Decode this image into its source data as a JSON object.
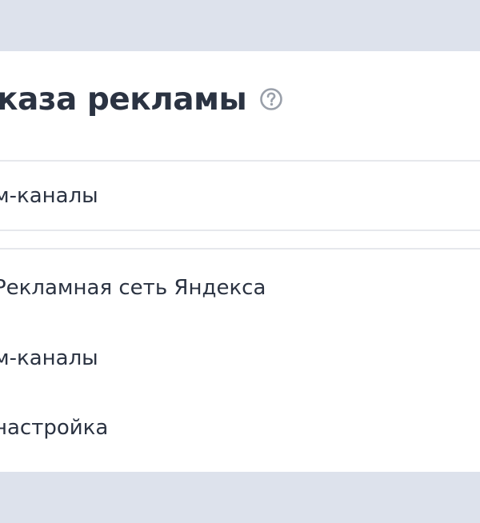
{
  "panel": {
    "title": "каза рекламы",
    "help_icon": "question-circle-icon"
  },
  "selected": {
    "label": "м-каналы"
  },
  "options": [
    {
      "label": "Рекламная сеть Яндекса"
    },
    {
      "label": "м-каналы"
    },
    {
      "label": "настройка"
    }
  ],
  "colors": {
    "background": "#dde2ec",
    "card": "#ffffff",
    "text": "#2b3342",
    "icon": "#9aa0aa",
    "divider": "#e6e8ec"
  }
}
